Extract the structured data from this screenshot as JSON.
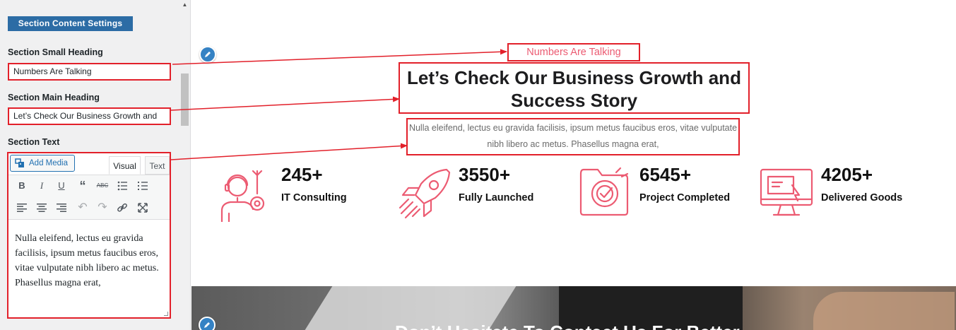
{
  "sidebar": {
    "section_button": "Section Content Settings",
    "small_heading_label": "Section Small Heading",
    "small_heading_value": "Numbers Are Talking",
    "main_heading_label": "Section Main Heading",
    "main_heading_value": "Let’s Check Our Business Growth and",
    "text_label": "Section Text",
    "editor": {
      "add_media": "Add Media",
      "tab_visual": "Visual",
      "tab_text": "Text",
      "toolbar_row1": [
        "bold-icon",
        "italic-icon",
        "underline-icon",
        "blockquote-icon",
        "strikethrough-icon",
        "bulleted-list-icon",
        "numbered-list-icon"
      ],
      "toolbar_row2": [
        "align-left-icon",
        "align-center-icon",
        "align-right-icon",
        "undo-icon",
        "redo-icon",
        "link-icon",
        "fullscreen-icon"
      ],
      "content": "Nulla eleifend, lectus eu gravida facilisis, ipsum metus faucibus eros, vitae vulputate nibh libero ac metus. Phasellus magna erat,"
    }
  },
  "preview": {
    "small_heading": "Numbers Are Talking",
    "main_heading_line1": "Let’s Check Our Business Growth and",
    "main_heading_line2": "Success Story",
    "section_text": "Nulla eleifend, lectus eu gravida facilisis, ipsum metus faucibus eros, vitae vulputate nibh libero ac metus. Phasellus magna erat,",
    "stats": [
      {
        "number": "245+",
        "label": "IT Consulting",
        "icon": "consultant-icon"
      },
      {
        "number": "3550+",
        "label": "Fully Launched",
        "icon": "rocket-icon"
      },
      {
        "number": "6545+",
        "label": "Project Completed",
        "icon": "target-folder-icon"
      },
      {
        "number": "4205+",
        "label": "Delivered Goods",
        "icon": "monitor-icon"
      }
    ],
    "cta_heading": "Don’t Hesitate To Contact Us For Better"
  },
  "colors": {
    "accent_blue": "#2c6ca5",
    "highlight_red": "#e2202a",
    "icon_pink": "#ec5b72"
  }
}
